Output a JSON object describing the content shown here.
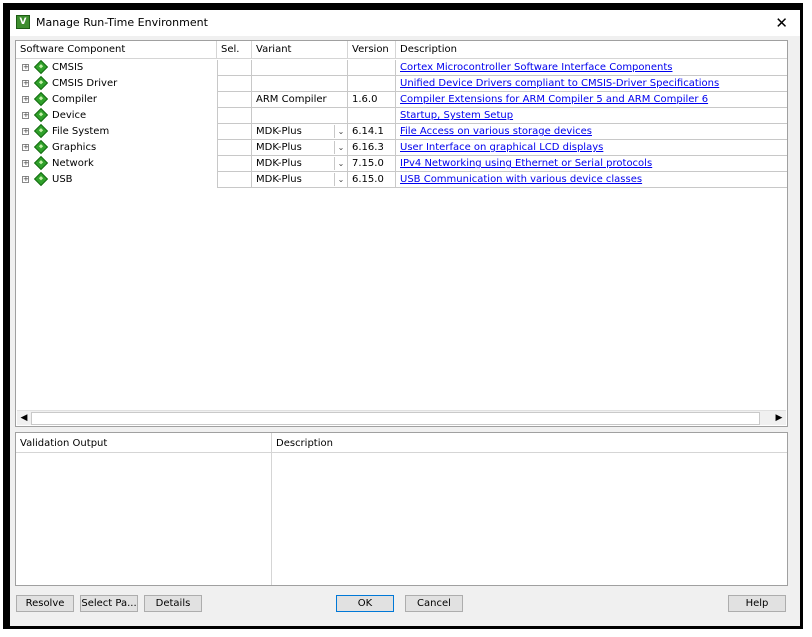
{
  "window": {
    "title": "Manage Run-Time Environment",
    "close_glyph": "✕",
    "app_icon_glyph": "V",
    "app_icon_name": "keil-uvision-icon"
  },
  "components_table": {
    "headers": {
      "component": "Software Component",
      "sel": "Sel.",
      "variant": "Variant",
      "version": "Version",
      "description": "Description"
    },
    "rows": [
      {
        "name": "CMSIS",
        "variant": "",
        "has_dropdown": false,
        "version": "",
        "description": "Cortex Microcontroller Software Interface Components"
      },
      {
        "name": "CMSIS Driver",
        "variant": "",
        "has_dropdown": false,
        "version": "",
        "description": "Unified Device Drivers compliant to CMSIS-Driver Specifications"
      },
      {
        "name": "Compiler",
        "variant": "ARM Compiler",
        "has_dropdown": false,
        "version": "1.6.0",
        "description": "Compiler Extensions for ARM Compiler 5 and ARM Compiler 6"
      },
      {
        "name": "Device",
        "variant": "",
        "has_dropdown": false,
        "version": "",
        "description": "Startup, System Setup"
      },
      {
        "name": "File System",
        "variant": "MDK-Plus",
        "has_dropdown": true,
        "version": "6.14.1",
        "description": "File Access on various storage devices"
      },
      {
        "name": "Graphics",
        "variant": "MDK-Plus",
        "has_dropdown": true,
        "version": "6.16.3",
        "description": "User Interface on graphical LCD displays"
      },
      {
        "name": "Network",
        "variant": "MDK-Plus",
        "has_dropdown": true,
        "version": "7.15.0",
        "description": "IPv4 Networking using Ethernet or Serial protocols"
      },
      {
        "name": "USB",
        "variant": "MDK-Plus",
        "has_dropdown": true,
        "version": "6.15.0",
        "description": "USB Communication with various device classes"
      }
    ],
    "expander_glyph": "+",
    "dropdown_glyph": "⌄",
    "scroll_left_glyph": "◀",
    "scroll_right_glyph": "▶",
    "colors": {
      "link": "#0000ee",
      "component_icon": "#2fa12a"
    }
  },
  "validation": {
    "headers": {
      "output": "Validation Output",
      "description": "Description"
    }
  },
  "buttons": {
    "resolve": "Resolve",
    "select_packs": "Select Pa...",
    "details": "Details",
    "ok": "OK",
    "cancel": "Cancel",
    "help": "Help"
  }
}
